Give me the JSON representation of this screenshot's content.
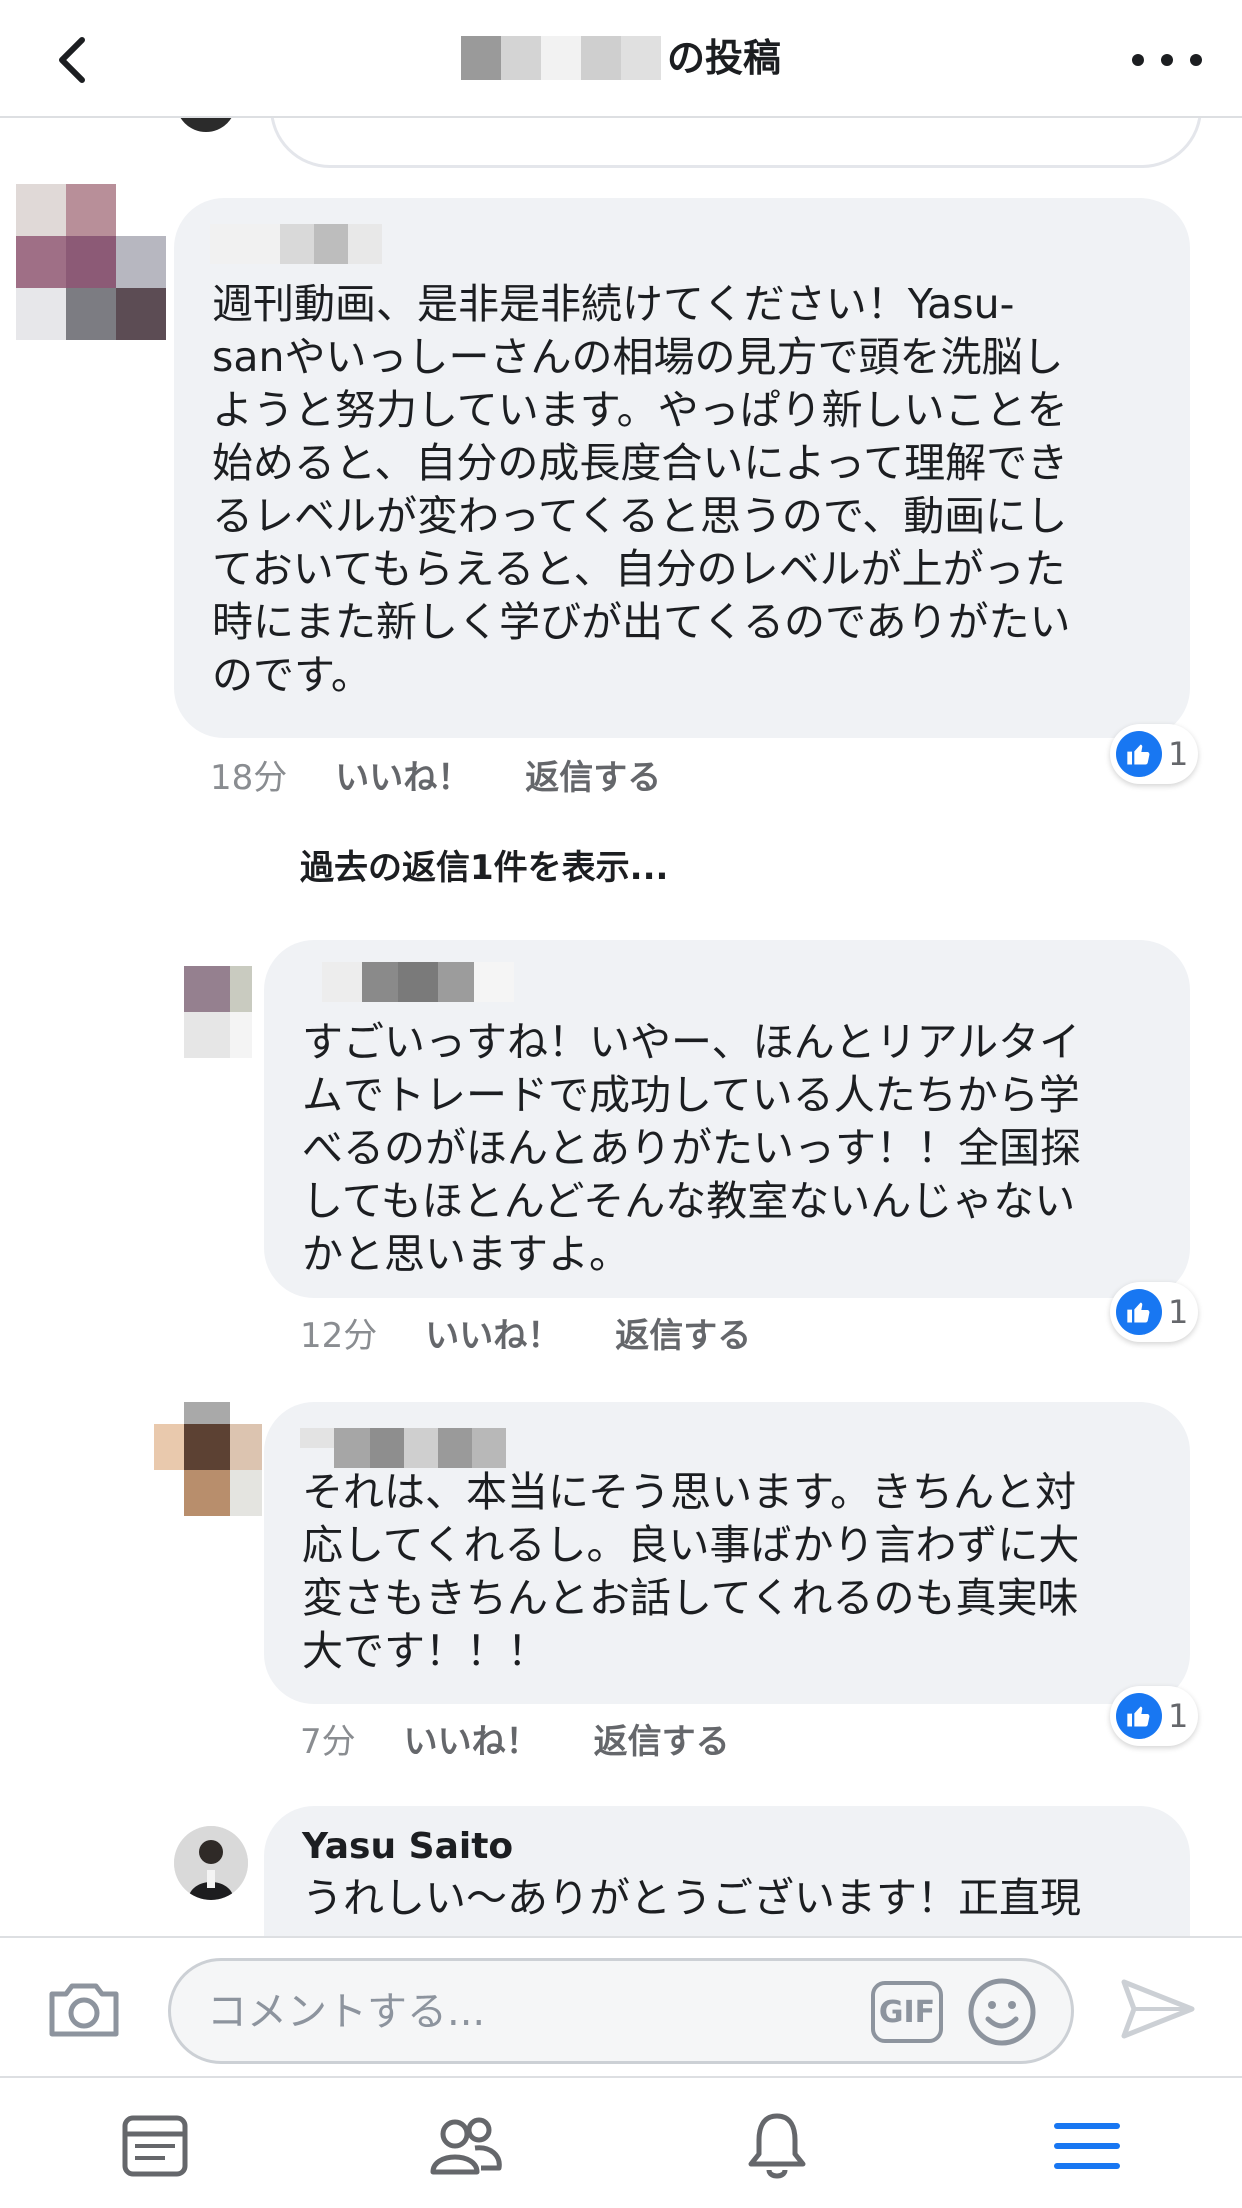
{
  "header": {
    "title": "の投稿"
  },
  "view_previous_replies": "過去の返信1件を表示...",
  "comments": [
    {
      "text": "週刊動画、是非是非続けてください！Yasu-\nsanやいっしーさんの相場の見方で頭を洗脳し\nようと努力しています。やっぱり新しいことを\n始めると、自分の成長度合いによって理解でき\nるレベルが変わってくると思うので、動画にし\nておいてもらえると、自分のレベルが上がった\n時にまた新しく学びが出てくるのでありがたい\nのです。",
      "time": "18分",
      "like_label": "いいね！",
      "reply_label": "返信する",
      "reaction_count": "1"
    },
    {
      "text": "すごいっすね！いやー、ほんとリアルタイ\nムでトレードで成功している人たちから学\nべるのがほんとありがたいっす！！全国探\nしてもほとんどそんな教室ないんじゃない\nかと思いますよ。",
      "time": "12分",
      "like_label": "いいね！",
      "reply_label": "返信する",
      "reaction_count": "1"
    },
    {
      "text": "それは、本当にそう思います。きちんと対\n応してくれるし。良い事ばかり言わずに大\n変さもきちんとお話してくれるのも真実味\n大です！！！",
      "time": "7分",
      "like_label": "いいね！",
      "reply_label": "返信する",
      "reaction_count": "1"
    },
    {
      "name": "Yasu Saito",
      "text": "うれしい〜ありがとうございます！正直現"
    }
  ],
  "composer": {
    "placeholder": "コメントする...",
    "gif_label": "GIF"
  },
  "icons": {
    "back": "chevron-left-icon",
    "more": "more-horizontal-icon",
    "like": "thumbs-up-icon",
    "camera": "camera-icon",
    "emoji": "smiley-icon",
    "send": "send-icon",
    "tabs": [
      "news-feed-icon",
      "friends-icon",
      "notifications-bell-icon",
      "menu-icon"
    ]
  },
  "colors": {
    "accent": "#1877f2",
    "bubble": "#f0f2f5",
    "muted_text": "#65676b"
  }
}
